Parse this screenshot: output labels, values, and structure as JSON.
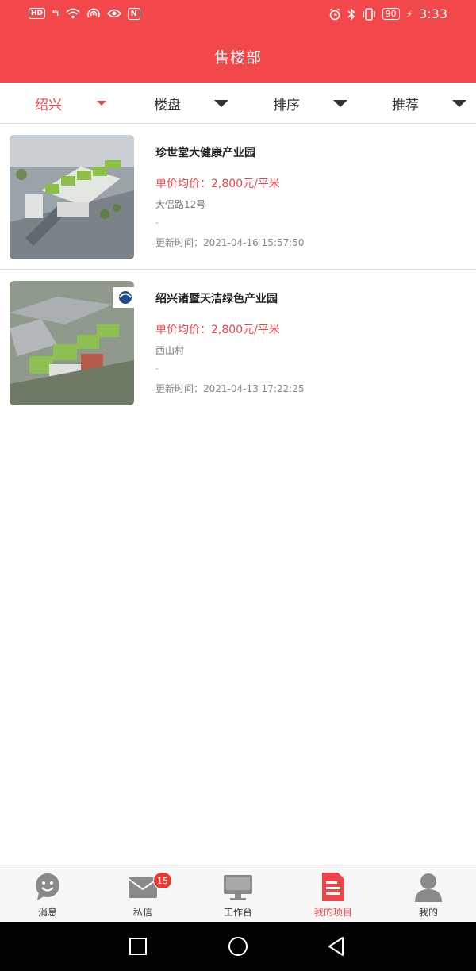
{
  "status_bar": {
    "hd": "HD",
    "signal": "⁴⁶ıl",
    "nfc": "N",
    "battery": "90",
    "time": "3:33"
  },
  "header": {
    "title": "售楼部"
  },
  "filters": [
    {
      "label": "绍兴",
      "active": true
    },
    {
      "label": "楼盘",
      "active": false
    },
    {
      "label": "排序",
      "active": false
    },
    {
      "label": "推荐",
      "active": false
    }
  ],
  "listings": [
    {
      "title": "珍世堂大健康产业园",
      "price": "单价均价：2,800元/平米",
      "address": "大侣路12号",
      "extra": "-",
      "updated": "更新时间：2021-04-16 15:57:50"
    },
    {
      "title": "绍兴诸暨天洁绿色产业园",
      "price": "单价均价：2,800元/平米",
      "address": "西山村",
      "extra": "-",
      "updated": "更新时间：2021-04-13 17:22:25"
    }
  ],
  "tabbar": {
    "items": [
      {
        "label": "消息",
        "icon": "chat-bubble-icon",
        "active": false
      },
      {
        "label": "私信",
        "icon": "envelope-icon",
        "active": false,
        "badge": "15"
      },
      {
        "label": "工作台",
        "icon": "monitor-icon",
        "active": false
      },
      {
        "label": "我的项目",
        "icon": "document-icon",
        "active": true
      },
      {
        "label": "我的",
        "icon": "person-icon",
        "active": false
      }
    ]
  },
  "colors": {
    "brand": "#f2474b",
    "accent_text": "#e8474c",
    "badge": "#e3392f"
  }
}
